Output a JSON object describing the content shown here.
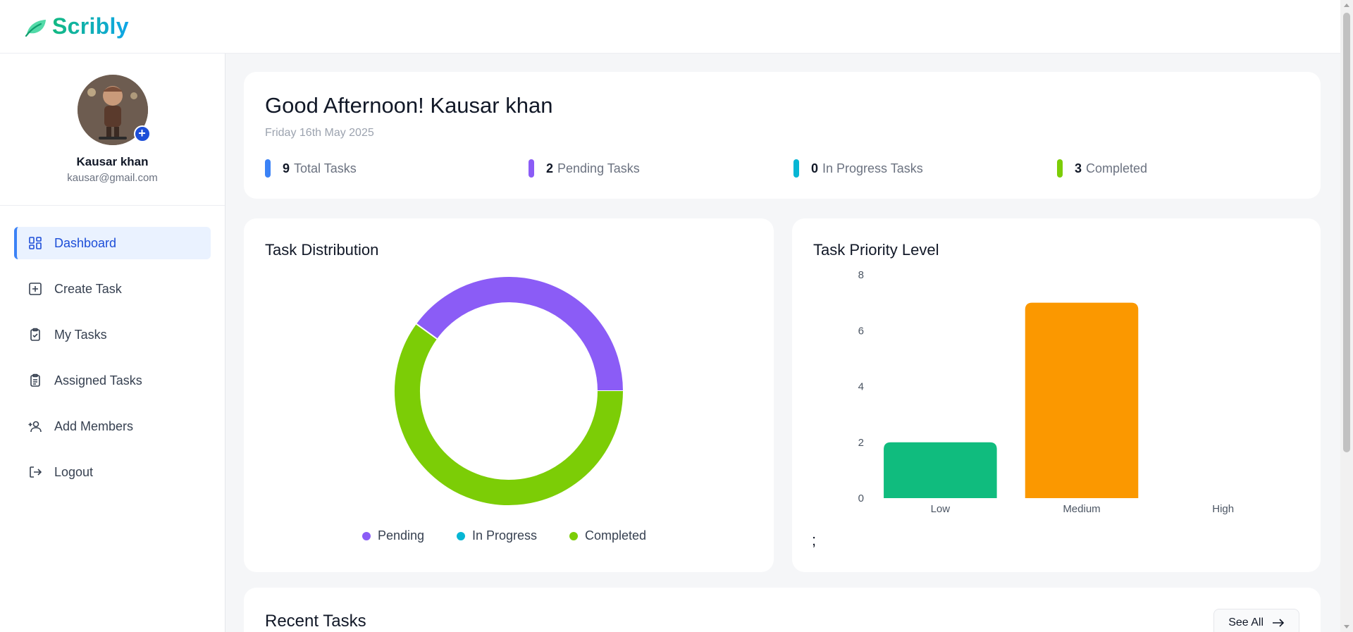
{
  "app": {
    "name": "Scribly"
  },
  "profile": {
    "name": "Kausar khan",
    "email": "kausar@gmail.com"
  },
  "nav": [
    {
      "label": "Dashboard",
      "icon": "dashboard-icon",
      "active": true
    },
    {
      "label": "Create Task",
      "icon": "plus-square-icon",
      "active": false
    },
    {
      "label": "My Tasks",
      "icon": "clipboard-check-icon",
      "active": false
    },
    {
      "label": "Assigned Tasks",
      "icon": "clipboard-list-icon",
      "active": false
    },
    {
      "label": "Add Members",
      "icon": "user-plus-icon",
      "active": false
    },
    {
      "label": "Logout",
      "icon": "logout-icon",
      "active": false
    }
  ],
  "greeting": {
    "title": "Good Afternoon! Kausar khan",
    "date": "Friday 16th May 2025"
  },
  "stats": [
    {
      "value": "9",
      "label": "Total Tasks",
      "color": "#3b82f6"
    },
    {
      "value": "2",
      "label": "Pending Tasks",
      "color": "#8b5cf6"
    },
    {
      "value": "0",
      "label": "In Progress Tasks",
      "color": "#06b6d4"
    },
    {
      "value": "3",
      "label": "Completed",
      "color": "#7ccd06"
    }
  ],
  "distribution": {
    "title": "Task Distribution",
    "legend": [
      {
        "label": "Pending",
        "color": "#8b5cf6"
      },
      {
        "label": "In Progress",
        "color": "#06b6d4"
      },
      {
        "label": "Completed",
        "color": "#7ccd06"
      }
    ]
  },
  "priority": {
    "title": "Task Priority Level",
    "trailing_text": ";"
  },
  "recent": {
    "title": "Recent Tasks",
    "see_all": "See All"
  },
  "chart_data": [
    {
      "type": "pie",
      "categories": [
        "Pending",
        "In Progress",
        "Completed"
      ],
      "values": [
        2,
        0,
        3
      ],
      "colors": [
        "#8b5cf6",
        "#06b6d4",
        "#7ccd06"
      ],
      "title": "Task Distribution",
      "donut": true,
      "legend": "bottom"
    },
    {
      "type": "bar",
      "categories": [
        "Low",
        "Medium",
        "High"
      ],
      "values": [
        2,
        7,
        0
      ],
      "colors": [
        "#10bc7e",
        "#fb9800",
        "#ef4444"
      ],
      "title": "Task Priority Level",
      "yticks": [
        "0",
        "2",
        "4",
        "6",
        "8"
      ],
      "ylim": [
        0,
        8
      ],
      "grid": false
    }
  ]
}
